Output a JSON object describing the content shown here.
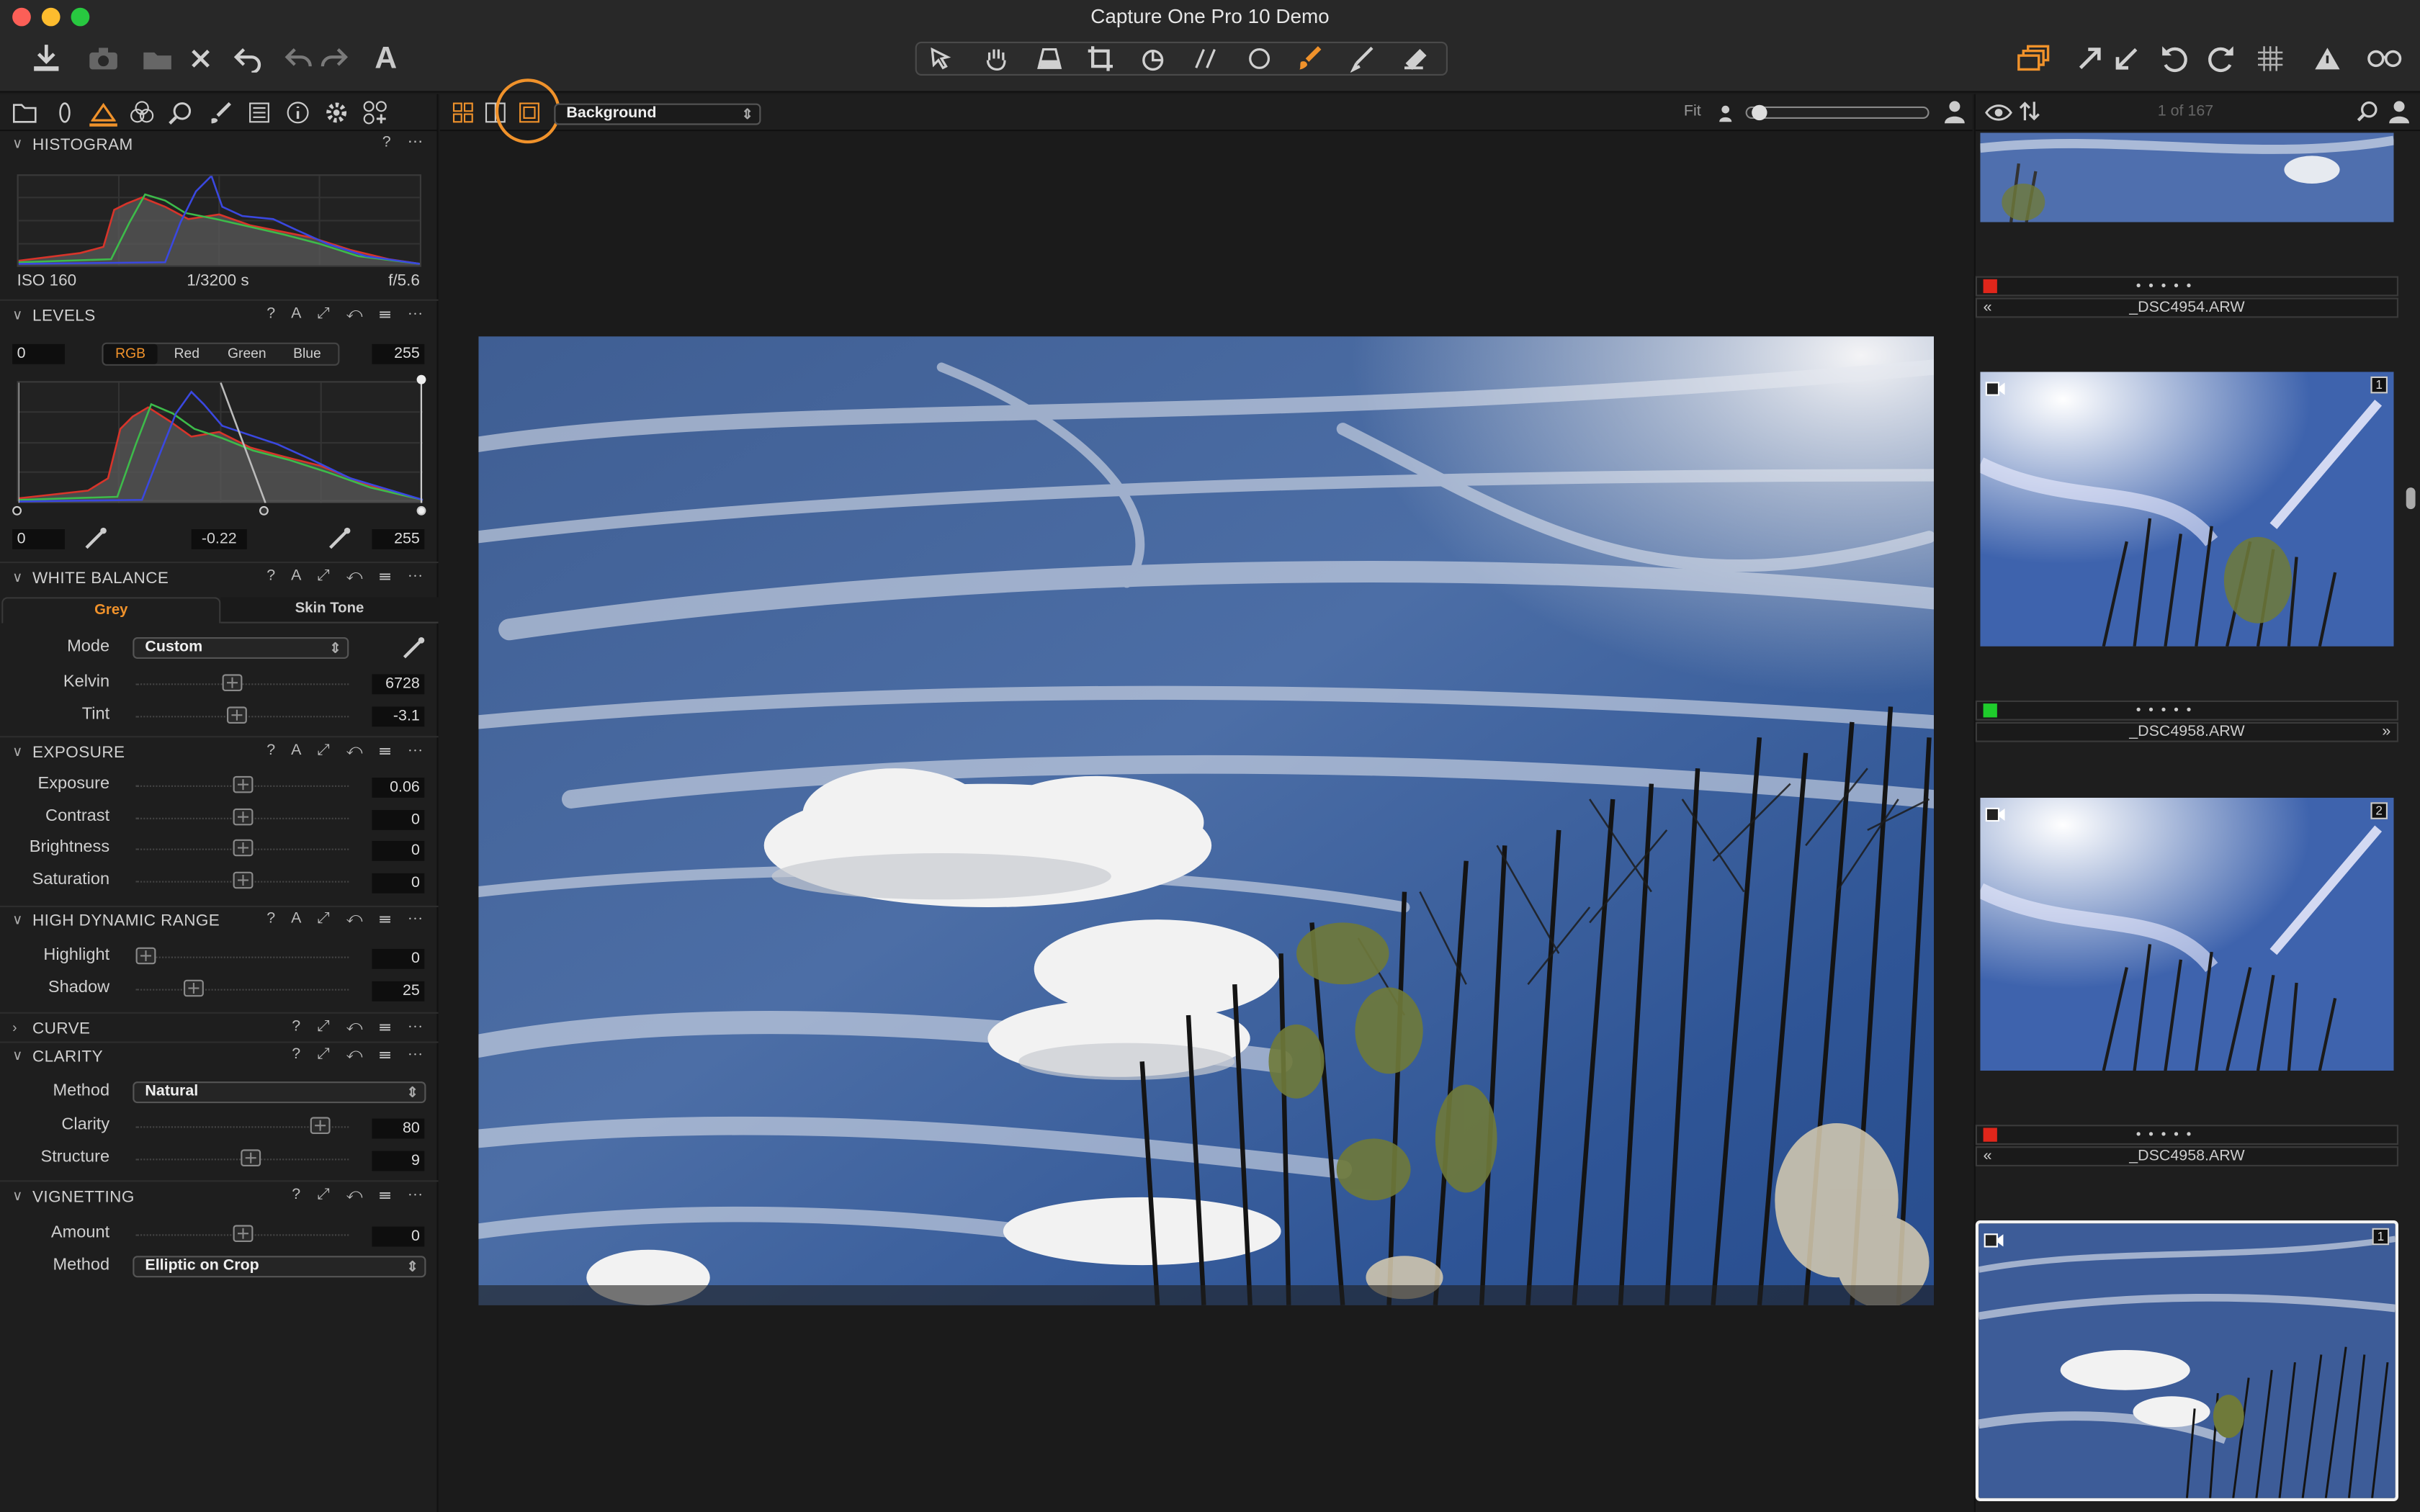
{
  "window": {
    "title": "Capture One Pro 10 Demo"
  },
  "toolbar": {
    "left_icons": [
      "import-icon",
      "camera-icon",
      "batch-icon",
      "delete-icon",
      "undo-icon",
      "undo-arrow-icon",
      "redo-arrow-icon",
      "text-icon"
    ],
    "cursor_tools": [
      "pointer-icon",
      "hand-icon",
      "keystone-icon",
      "crop-icon",
      "rotate-icon",
      "straighten-icon",
      "spot-icon",
      "brush-icon",
      "picker-icon",
      "eraser-icon"
    ],
    "right_icons": [
      "stack-icon",
      "process-icon",
      "copy-icon",
      "reset-icon",
      "redo-icon",
      "grid-icon",
      "warning-icon",
      "glasses-icon"
    ]
  },
  "tool_tabs": [
    "library-icon",
    "capture-icon",
    "adjust-icon",
    "color-icon",
    "lens-icon",
    "local-icon",
    "details-icon",
    "metadata-icon",
    "settings-icon",
    "custom-icon"
  ],
  "histogram": {
    "title": "HISTOGRAM",
    "iso": "ISO 160",
    "shutter": "1/3200 s",
    "aperture": "f/5.6"
  },
  "levels": {
    "title": "LEVELS",
    "channels": [
      "RGB",
      "Red",
      "Green",
      "Blue"
    ],
    "active_channel": "RGB",
    "input_min": "0",
    "input_max": "255",
    "output_min": "0",
    "midpoint": "-0.22",
    "output_max": "255"
  },
  "white_balance": {
    "title": "WHITE BALANCE",
    "tabs": [
      "Grey",
      "Skin Tone"
    ],
    "mode_label": "Mode",
    "mode_value": "Custom",
    "kelvin_label": "Kelvin",
    "kelvin_value": "6728",
    "kelvin_pos": 0.45,
    "tint_label": "Tint",
    "tint_value": "-3.1",
    "tint_pos": 0.47
  },
  "exposure": {
    "title": "EXPOSURE",
    "rows": [
      {
        "label": "Exposure",
        "value": "0.06",
        "pos": 0.5
      },
      {
        "label": "Contrast",
        "value": "0",
        "pos": 0.5
      },
      {
        "label": "Brightness",
        "value": "0",
        "pos": 0.5
      },
      {
        "label": "Saturation",
        "value": "0",
        "pos": 0.5
      }
    ]
  },
  "hdr": {
    "title": "HIGH DYNAMIC RANGE",
    "rows": [
      {
        "label": "Highlight",
        "value": "0",
        "pos": 0.0
      },
      {
        "label": "Shadow",
        "value": "25",
        "pos": 0.25
      }
    ]
  },
  "curve": {
    "title": "CURVE"
  },
  "clarity": {
    "title": "CLARITY",
    "method_label": "Method",
    "method_value": "Natural",
    "rows": [
      {
        "label": "Clarity",
        "value": "80",
        "pos": 0.9
      },
      {
        "label": "Structure",
        "value": "9",
        "pos": 0.54
      }
    ]
  },
  "vignetting": {
    "title": "VIGNETTING",
    "amount_label": "Amount",
    "amount_value": "0",
    "amount_pos": 0.5,
    "method_label": "Method",
    "method_value": "Elliptic on Crop"
  },
  "viewer": {
    "layer": "Background",
    "fit_label": "Fit",
    "counter": "1 of 167"
  },
  "browser": {
    "items": [
      {
        "name": "_DSC4954.ARW",
        "label_color": "#e0261b",
        "badge": "",
        "nav": "«"
      },
      {
        "name": "_DSC4958.ARW",
        "label_color": "#1fcc2c",
        "badge": "1",
        "nav": "»"
      },
      {
        "name": "_DSC4958.ARW",
        "label_color": "#e0261b",
        "badge": "2",
        "nav": "«"
      },
      {
        "name": "",
        "label_color": "",
        "badge": "1",
        "nav": ""
      }
    ]
  },
  "colors": {
    "accent": "#f0922b",
    "histogram_red": "#d8342a",
    "histogram_green": "#3dbb4a",
    "histogram_blue": "#3a48e0"
  }
}
